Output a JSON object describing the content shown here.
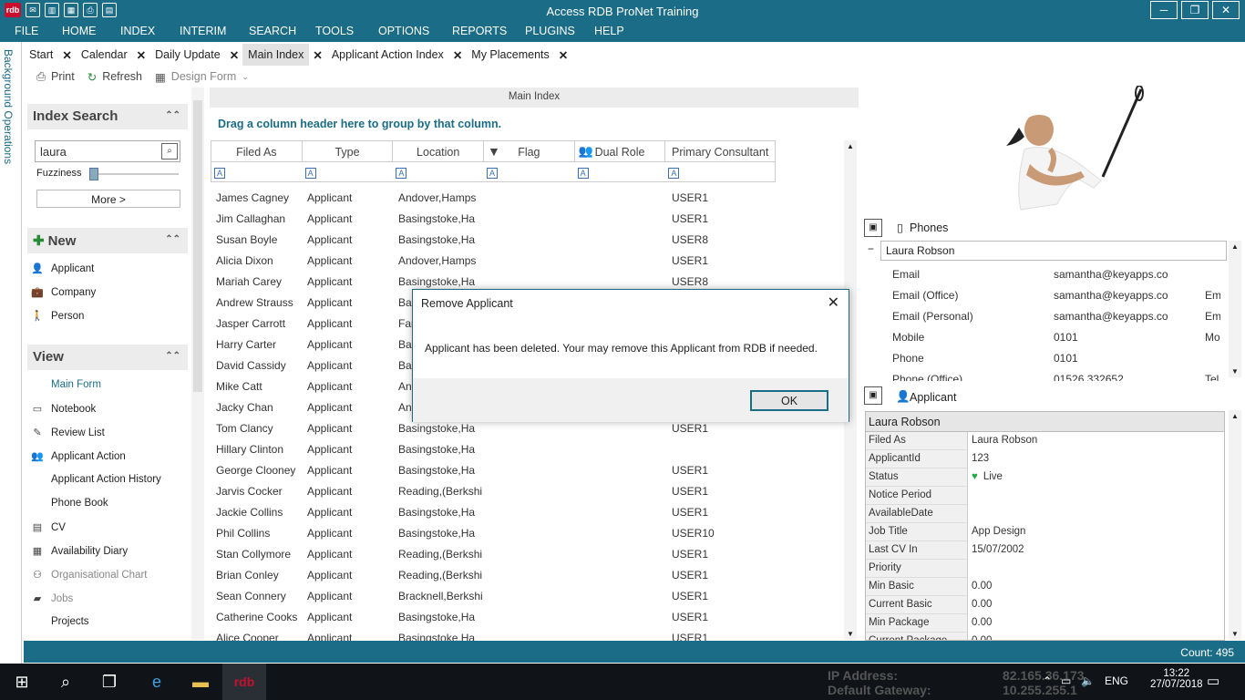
{
  "window": {
    "title": "Access RDB ProNet Training",
    "logo": "rdb"
  },
  "menu": [
    "FILE",
    "HOME",
    "INDEX",
    "INTERIM",
    "SEARCH",
    "TOOLS",
    "OPTIONS",
    "REPORTS",
    "PLUGINS",
    "HELP"
  ],
  "side_tab": "Background Operations",
  "tabs": [
    {
      "label": "Start"
    },
    {
      "label": "Calendar"
    },
    {
      "label": "Daily Update"
    },
    {
      "label": "Main Index",
      "active": true
    },
    {
      "label": "Applicant Action Index"
    },
    {
      "label": "My Placements"
    }
  ],
  "toolbar": {
    "print": "Print",
    "refresh": "Refresh",
    "design_form": "Design Form"
  },
  "index_search": {
    "heading": "Index Search",
    "query": "laura",
    "fuzziness_label": "Fuzziness",
    "more_button": "More >"
  },
  "new_section": {
    "heading": "New",
    "items": [
      "Applicant",
      "Company",
      "Person"
    ]
  },
  "view_section": {
    "heading": "View",
    "items": [
      "Main Form",
      "Notebook",
      "Review List",
      "Applicant Action",
      "Applicant Action History",
      "Phone Book",
      "CV",
      "Availability Diary",
      "Organisational Chart",
      "Jobs",
      "Projects"
    ]
  },
  "main": {
    "heading": "Main Index",
    "group_hint": "Drag a column header here to group by that column.",
    "columns": [
      "Filed As",
      "Type",
      "Location",
      "Flag",
      "Dual Role",
      "Primary Consultant"
    ],
    "rows": [
      [
        "James Cagney",
        "Applicant",
        "Andover,Hamps",
        "",
        "",
        "USER1"
      ],
      [
        "Jim Callaghan",
        "Applicant",
        "Basingstoke,Ha",
        "",
        "",
        "USER1"
      ],
      [
        "Susan Boyle",
        "Applicant",
        "Basingstoke,Ha",
        "",
        "",
        "USER8"
      ],
      [
        "Alicia Dixon",
        "Applicant",
        "Andover,Hamps",
        "",
        "",
        "USER1"
      ],
      [
        "Mariah Carey",
        "Applicant",
        "Basingstoke,Ha",
        "",
        "",
        "USER8"
      ],
      [
        "Andrew Strauss",
        "Applicant",
        "Bas",
        "",
        "",
        ""
      ],
      [
        "Jasper Carrott",
        "Applicant",
        "Far",
        "",
        "",
        ""
      ],
      [
        "Harry Carter",
        "Applicant",
        "Bas",
        "",
        "",
        ""
      ],
      [
        "David Cassidy",
        "Applicant",
        "Bas",
        "",
        "",
        ""
      ],
      [
        "Mike Catt",
        "Applicant",
        "An",
        "",
        "",
        ""
      ],
      [
        "Jacky Chan",
        "Applicant",
        "An",
        "",
        "",
        ""
      ],
      [
        "Tom Clancy",
        "Applicant",
        "Basingstoke,Ha",
        "",
        "",
        "USER1"
      ],
      [
        "Hillary Clinton",
        "Applicant",
        "Basingstoke,Ha",
        "",
        "",
        ""
      ],
      [
        "George Clooney",
        "Applicant",
        "Basingstoke,Ha",
        "",
        "",
        "USER1"
      ],
      [
        "Jarvis Cocker",
        "Applicant",
        "Reading,(Berkshi",
        "",
        "",
        "USER1"
      ],
      [
        "Jackie Collins",
        "Applicant",
        "Basingstoke,Ha",
        "",
        "",
        "USER1"
      ],
      [
        "Phil Collins",
        "Applicant",
        "Basingstoke,Ha",
        "",
        "",
        "USER10"
      ],
      [
        "Stan Collymore",
        "Applicant",
        "Reading,(Berkshi",
        "",
        "",
        "USER1"
      ],
      [
        "Brian Conley",
        "Applicant",
        "Reading,(Berkshi",
        "",
        "",
        "USER1"
      ],
      [
        "Sean Connery",
        "Applicant",
        "Bracknell,Berkshi",
        "",
        "",
        "USER1"
      ],
      [
        "Catherine Cooks",
        "Applicant",
        "Basingstoke,Ha",
        "",
        "",
        "USER1"
      ],
      [
        "Alice Cooper",
        "Applicant",
        "Basingstoke,Ha",
        "",
        "",
        "USER1"
      ]
    ]
  },
  "phones": {
    "heading": "Phones",
    "contact": "Laura Robson",
    "rows": [
      {
        "label": "Email",
        "value": "samantha@keyapps.co",
        "extra": ""
      },
      {
        "label": "Email (Office)",
        "value": "samantha@keyapps.co",
        "extra": "Em"
      },
      {
        "label": "Email (Personal)",
        "value": "samantha@keyapps.co",
        "extra": "Em"
      },
      {
        "label": "Mobile",
        "value": "0101",
        "extra": "Mo"
      },
      {
        "label": "Phone",
        "value": "0101",
        "extra": ""
      },
      {
        "label": "Phone (Office)",
        "value": "01526 332652",
        "extra": "Tel"
      }
    ]
  },
  "applicant": {
    "heading": "Applicant",
    "name": "Laura Robson",
    "fields": [
      {
        "k": "Filed As",
        "v": "Laura Robson"
      },
      {
        "k": "ApplicantId",
        "v": "123"
      },
      {
        "k": "Status",
        "v": "Live"
      },
      {
        "k": "Notice Period",
        "v": ""
      },
      {
        "k": "AvailableDate",
        "v": ""
      },
      {
        "k": "Job Title",
        "v": "App Design"
      },
      {
        "k": "Last CV In",
        "v": "15/07/2002"
      },
      {
        "k": "Priority",
        "v": ""
      },
      {
        "k": "Min Basic",
        "v": "0.00"
      },
      {
        "k": "Current Basic",
        "v": "0.00"
      },
      {
        "k": "Min Package",
        "v": "0.00"
      },
      {
        "k": "Current Package",
        "v": "0.00"
      }
    ]
  },
  "status": {
    "count": "Count: 495"
  },
  "dialog": {
    "title": "Remove Applicant",
    "message": "Applicant has been deleted. Your may remove this Applicant from RDB if needed.",
    "ok": "OK"
  },
  "taskbar": {
    "ip_label": "IP Address:",
    "ip_value": "82.165.36.173",
    "gw_label": "Default Gateway:",
    "gw_value": "10.255.255.1",
    "lang": "ENG",
    "time": "13:22",
    "date": "27/07/2018"
  },
  "colors": {
    "brand": "#1b6c86",
    "status_live": "#22aa44"
  }
}
